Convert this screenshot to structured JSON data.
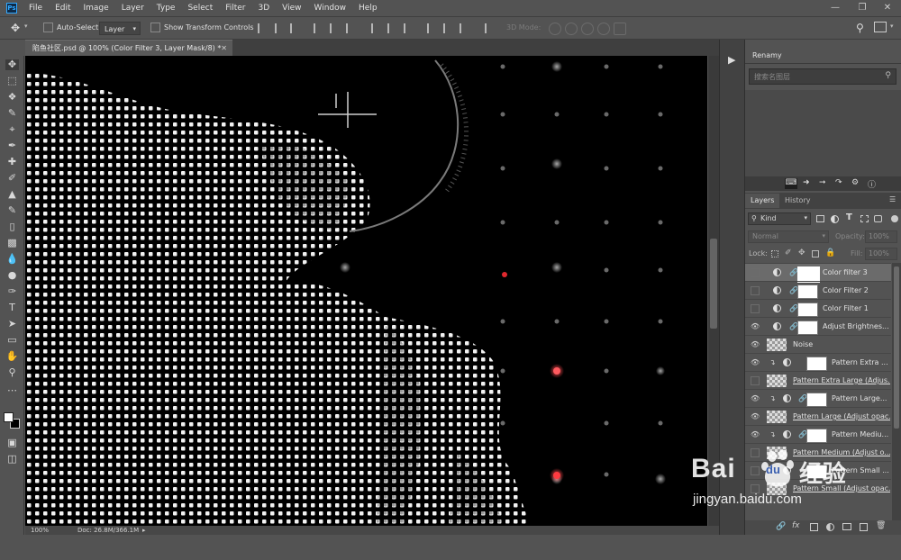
{
  "menubar": {
    "items": [
      "File",
      "Edit",
      "Image",
      "Layer",
      "Type",
      "Select",
      "Filter",
      "3D",
      "View",
      "Window",
      "Help"
    ]
  },
  "options": {
    "auto_select_label": "Auto-Select:",
    "auto_select_value": "Layer",
    "transform_label": "Show Transform Controls",
    "mode_3d_label": "3D Mode:"
  },
  "document": {
    "tab_title": "陷鱼社区.psd @ 100% (Color Filter 3, Layer Mask/8) *",
    "zoom": "100%",
    "doc_size": "Doc: 26.8M/366.1M"
  },
  "renamy": {
    "title": "Renamy",
    "search_placeholder": "搜索名图层"
  },
  "layers_panel": {
    "tabs": [
      "Layers",
      "History"
    ],
    "filter_label": "Kind",
    "blend_mode": "Normal",
    "opacity_label": "Opacity:",
    "opacity_value": "100%",
    "lock_label": "Lock:",
    "fill_label": "Fill:",
    "fill_value": "100%",
    "layers": [
      {
        "name": "Color filter 3",
        "visible": false,
        "selected": true
      },
      {
        "name": "Color Filter 2",
        "visible": false,
        "selected": false
      },
      {
        "name": "Color Filter 1",
        "visible": false,
        "selected": false
      },
      {
        "name": "Adjust Brightnes...",
        "visible": true,
        "selected": false
      },
      {
        "name": "Noise",
        "visible": true,
        "selected": false
      },
      {
        "name": "Pattern Extra ...",
        "visible": true,
        "selected": false
      },
      {
        "name": "Pattern Extra Large (Adjus...",
        "visible": false,
        "selected": false
      },
      {
        "name": "Pattern Large...",
        "visible": true,
        "selected": false
      },
      {
        "name": "Pattern Large (Adjust opac...",
        "visible": true,
        "selected": false
      },
      {
        "name": "Pattern Mediu...",
        "visible": true,
        "selected": false
      },
      {
        "name": "Pattern Medium (Adjust o...",
        "visible": false,
        "selected": false
      },
      {
        "name": "Pattern Small ...",
        "visible": false,
        "selected": false
      },
      {
        "name": "Pattern Small (Adjust opac...",
        "visible": false,
        "selected": false
      }
    ]
  },
  "watermark": {
    "brand": "Bai",
    "brand2": "du",
    "cn": "经验",
    "url": "jingyan.baidu.com"
  },
  "colors": {
    "ui_bg": "#535353",
    "canvas_bg": "#000000",
    "red_dot": "#e0282e",
    "ps_blue": "#31a8ff"
  }
}
